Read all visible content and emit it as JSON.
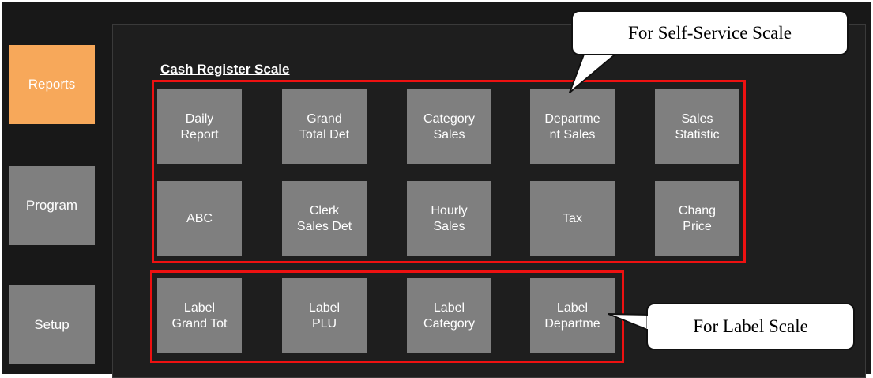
{
  "sidebar": {
    "items": [
      {
        "label": "Reports",
        "active": true
      },
      {
        "label": "Program",
        "active": false
      },
      {
        "label": "Setup",
        "active": false
      }
    ]
  },
  "main": {
    "section_title": "Cash Register Scale",
    "cash_register_row1": [
      "Daily\nReport",
      "Grand\nTotal Det",
      "Category\nSales",
      "Departme\nnt Sales",
      "Sales\nStatistic"
    ],
    "cash_register_row2": [
      "ABC",
      "Clerk\nSales Det",
      "Hourly\nSales",
      "Tax",
      "Chang\nPrice"
    ],
    "label_row": [
      "Label\nGrand Tot",
      "Label\nPLU",
      "Label\nCategory",
      "Label\nDepartme"
    ]
  },
  "callouts": {
    "self_service": "For Self-Service Scale",
    "label": "For Label Scale"
  },
  "colors": {
    "background": "#181818",
    "tile": "#7f7f7f",
    "active_tab": "#f7a85a",
    "highlight": "#ee1111",
    "callout_bg": "#ffffff"
  }
}
